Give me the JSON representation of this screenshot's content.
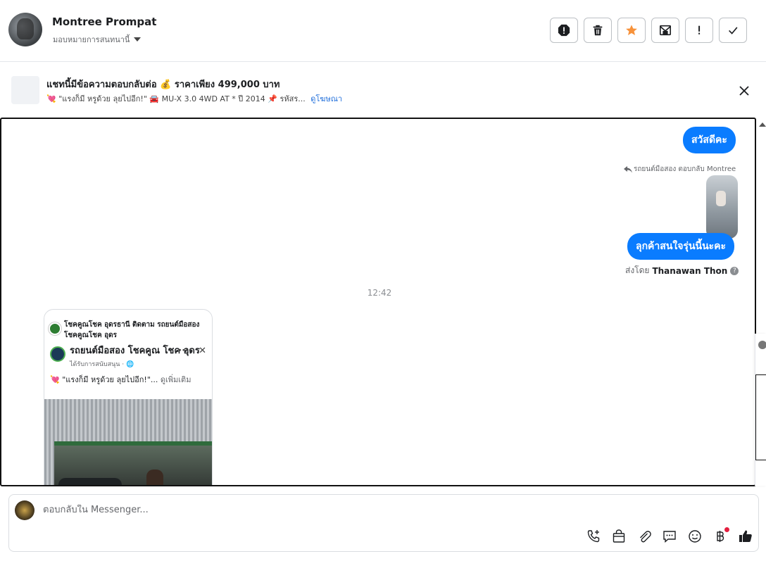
{
  "header": {
    "user_name": "Montree Prompat",
    "assign_label": "มอบหมายการสนทนานี้",
    "actions": [
      {
        "name": "spam-button",
        "icon": "alert-octagon-icon"
      },
      {
        "name": "delete-button",
        "icon": "trash-icon"
      },
      {
        "name": "star-button",
        "icon": "star-icon",
        "color": "#f7923b"
      },
      {
        "name": "archive-button",
        "icon": "envelope-archive-icon"
      },
      {
        "name": "important-button",
        "icon": "exclamation-icon"
      },
      {
        "name": "done-button",
        "icon": "check-icon"
      }
    ]
  },
  "ad": {
    "title": "แชทนี้มีข้อความตอบกลับต่อ 💰 ราคาเพียง 499,000 บาท",
    "subtitle": "💘 \"แรงก็มี หรูด้วย ลุยไปอีก!\" 🚘 MU-X 3.0 4WD AT * ปี 2014 📌 รหัสร...",
    "link": "ดูโฆษณา"
  },
  "messages": {
    "greeting": "สวัสดีคะ",
    "reply_note": "รถยนต์มือสอง ตอบกลับ Montree",
    "interest": "ลุกค้าสนใจรุ่นนี้นะคะ",
    "sent_by_prefix": "ส่งโดย",
    "sent_by_name": "Thanawan Thon",
    "help_glyph": "?",
    "timestamp": "12:42"
  },
  "post": {
    "header_text": "โชคคูณโชค อุดรธานี ติดตาม รถยนต์มือสอง โชคคูณโชค อุดร",
    "page_name": "รถยนต์มือสอง โชคคูณ โชค อุดร",
    "more_glyph": "···",
    "close_glyph": "✕",
    "sponsored": "ได้รับการสนับสนุน · 🌐",
    "text": "💘 \"แรงก็มี หรูด้วย ลุยไปอีก!\"...",
    "see_more": "ดูเพิ่มเติม"
  },
  "composer": {
    "placeholder": "ตอบกลับใน Messenger..."
  },
  "colors": {
    "accent": "#0a7cff",
    "link": "#216fdb",
    "star": "#f7923b",
    "like": "#1c1e21"
  }
}
